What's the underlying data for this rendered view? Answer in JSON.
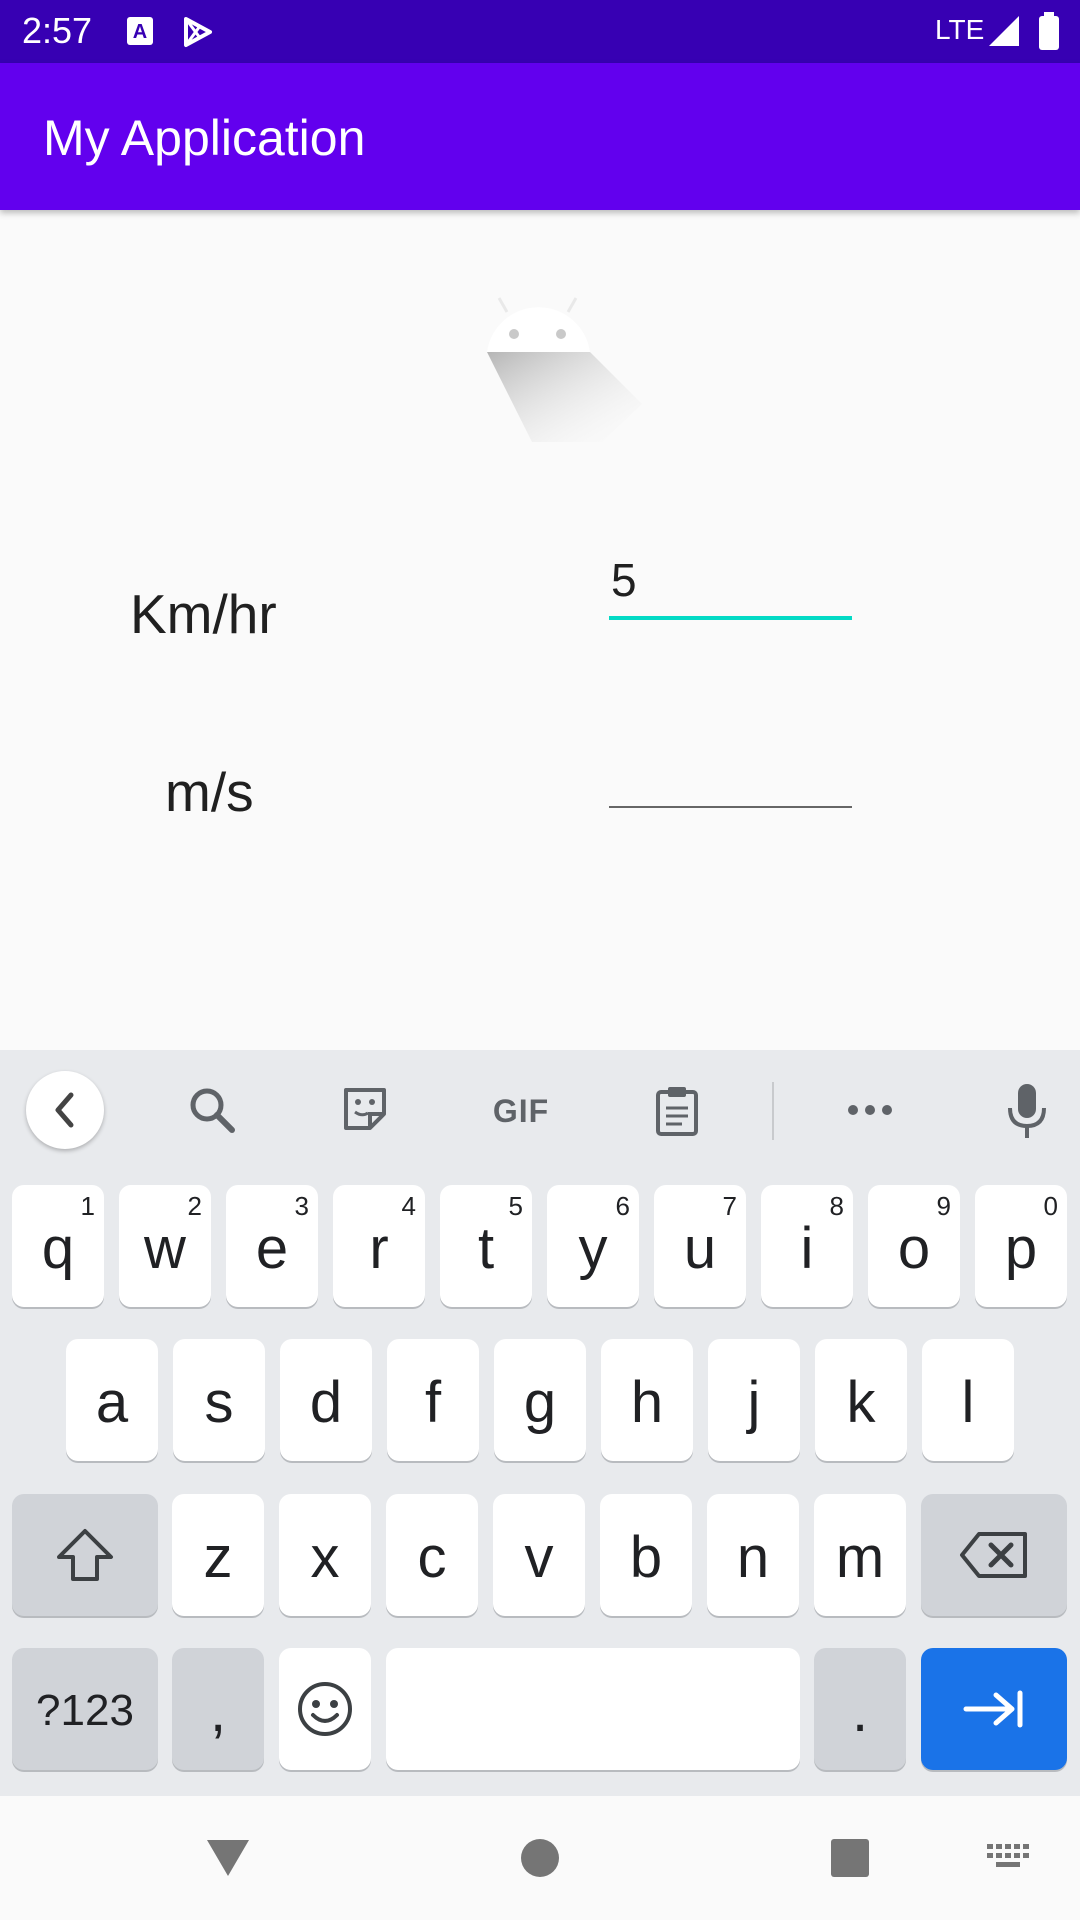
{
  "status_bar": {
    "time": "2:57",
    "network": "LTE",
    "icons": [
      "text-recognition-icon",
      "play-store-icon",
      "signal-icon",
      "battery-icon"
    ]
  },
  "app_bar": {
    "title": "My Application"
  },
  "content": {
    "logo_icon": "android-logo-icon",
    "kmhr_label": "Km/hr",
    "kmhr_value": "5",
    "ms_label": "m/s",
    "ms_value": ""
  },
  "keyboard": {
    "toolbar_icons": [
      "back-chevron-icon",
      "search-icon",
      "sticker-icon",
      "gif-icon",
      "clipboard-icon",
      "more-icon",
      "microphone-icon"
    ],
    "gif_label": "GIF",
    "row1": [
      {
        "label": "q",
        "hint": "1"
      },
      {
        "label": "w",
        "hint": "2"
      },
      {
        "label": "e",
        "hint": "3"
      },
      {
        "label": "r",
        "hint": "4"
      },
      {
        "label": "t",
        "hint": "5"
      },
      {
        "label": "y",
        "hint": "6"
      },
      {
        "label": "u",
        "hint": "7"
      },
      {
        "label": "i",
        "hint": "8"
      },
      {
        "label": "o",
        "hint": "9"
      },
      {
        "label": "p",
        "hint": "0"
      }
    ],
    "row2": [
      "a",
      "s",
      "d",
      "f",
      "g",
      "h",
      "j",
      "k",
      "l"
    ],
    "row3": [
      "z",
      "x",
      "c",
      "v",
      "b",
      "n",
      "m"
    ],
    "symbols_label": "?123",
    "comma_label": ",",
    "period_label": ".",
    "space_label": "",
    "accent_color": "#1a73e8"
  },
  "nav_bar": {
    "icons": [
      "back-triangle-icon",
      "home-circle-icon",
      "recents-square-icon",
      "keyboard-switch-icon"
    ]
  }
}
